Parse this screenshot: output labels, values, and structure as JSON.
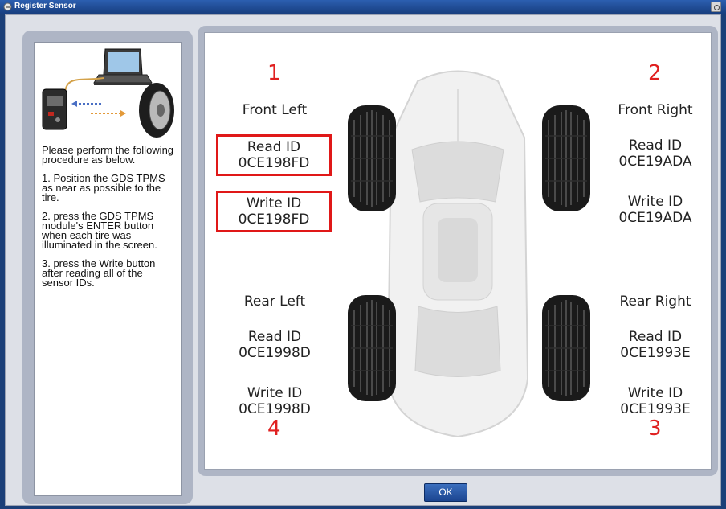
{
  "window": {
    "title": "Register Sensor"
  },
  "instructions": {
    "intro": "Please perform the following procedure as below.",
    "step1": "1. Position the GDS TPMS as near as possible to the tire.",
    "step2": "2. press the GDS TPMS module's ENTER button when each tire was illuminated in the screen.",
    "step3": "3. press the Write button after reading all of the sensor IDs."
  },
  "tires": {
    "front_left": {
      "number": "1",
      "name": "Front Left",
      "read_label": "Read ID",
      "read_id": "0CE198FD",
      "write_label": "Write ID",
      "write_id": "0CE198FD",
      "highlighted": true
    },
    "front_right": {
      "number": "2",
      "name": "Front Right",
      "read_label": "Read ID",
      "read_id": "0CE19ADA",
      "write_label": "Write ID",
      "write_id": "0CE19ADA",
      "highlighted": false
    },
    "rear_right": {
      "number": "3",
      "name": "Rear Right",
      "read_label": "Read ID",
      "read_id": "0CE1993E",
      "write_label": "Write ID",
      "write_id": "0CE1993E",
      "highlighted": false
    },
    "rear_left": {
      "number": "4",
      "name": "Rear Left",
      "read_label": "Read ID",
      "read_id": "0CE1998D",
      "write_label": "Write ID",
      "write_id": "0CE1998D",
      "highlighted": false
    }
  },
  "buttons": {
    "ok_label": "OK"
  },
  "colors": {
    "titlebar": "#1b3f78",
    "highlight": "#e01818",
    "tire_number": "#e02020",
    "panel_frame": "#aeb5c5"
  },
  "icons": [
    "window-icon",
    "close-window-icon",
    "laptop-icon",
    "tpms-module-icon",
    "tire-icon",
    "car-diagram-icon"
  ]
}
